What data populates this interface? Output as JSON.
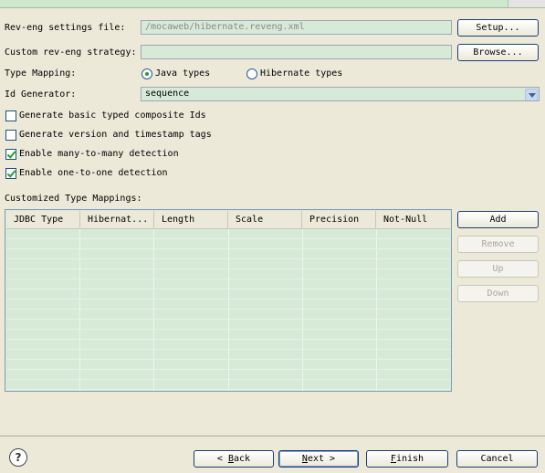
{
  "form": {
    "reveng_file_label": "Rev-eng settings file:",
    "reveng_file_value": "/mocaweb/hibernate.reveng.xml",
    "setup_button": "Setup...",
    "strategy_label": "Custom rev-eng strategy:",
    "strategy_value": "",
    "browse_button": "Browse...",
    "type_mapping_label": "Type Mapping:",
    "java_types": "Java types",
    "hibernate_types": "Hibernate types",
    "type_mapping_selected": "Java types",
    "id_generator_label": "Id Generator:",
    "id_generator_value": "sequence"
  },
  "options": [
    {
      "label": "Generate basic typed composite Ids",
      "checked": false
    },
    {
      "label": "Generate version and timestamp tags",
      "checked": false
    },
    {
      "label": "Enable many-to-many detection",
      "checked": true
    },
    {
      "label": "Enable one-to-one detection",
      "checked": true
    }
  ],
  "mappings": {
    "label": "Customized Type Mappings:",
    "columns": [
      "JDBC Type",
      "Hibernat...",
      "Length",
      "Scale",
      "Precision",
      "Not-Null"
    ],
    "rows": [],
    "add_button": "Add",
    "remove_button": "Remove",
    "up_button": "Up",
    "down_button": "Down"
  },
  "footer": {
    "help_icon": "question-mark",
    "back_prefix": "< ",
    "back_mnemonic": "B",
    "back_rest": "ack",
    "next_mnemonic": "N",
    "next_rest": "ext >",
    "finish_mnemonic": "F",
    "finish_rest": "inish",
    "cancel": "Cancel"
  }
}
